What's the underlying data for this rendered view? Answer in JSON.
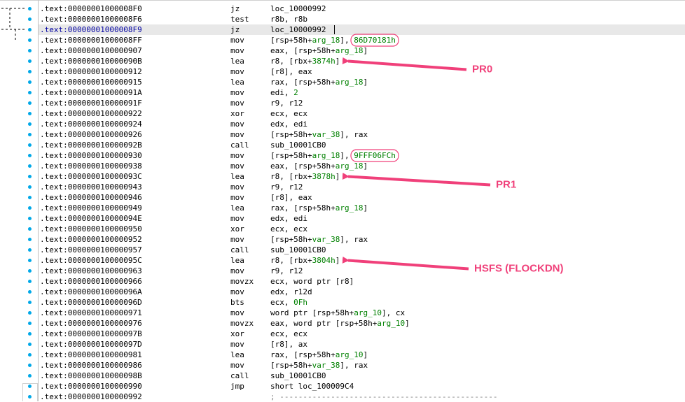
{
  "rows": [
    {
      "addr": ".text:00000001000008F0",
      "mnemonic": "jz",
      "parts": [
        {
          "t": "loc_10000992"
        }
      ]
    },
    {
      "addr": ".text:00000001000008F6",
      "mnemonic": "test",
      "parts": [
        {
          "t": "r8b, r8b"
        }
      ]
    },
    {
      "addr": ".text:00000001000008F9",
      "mnemonic": "jz",
      "parts": [
        {
          "t": "loc_10000992"
        }
      ]
    },
    {
      "addr": ".text:00000001000008FF",
      "mnemonic": "mov",
      "parts": [
        {
          "t": "[rsp+58h+"
        },
        {
          "t": "arg_18",
          "hl": true
        },
        {
          "t": "], "
        },
        {
          "t": "86D70181h",
          "hl": true
        }
      ]
    },
    {
      "addr": ".text:0000000100000907",
      "mnemonic": "mov",
      "parts": [
        {
          "t": "eax, [rsp+58h+"
        },
        {
          "t": "arg_18",
          "hl": true
        },
        {
          "t": "]"
        }
      ]
    },
    {
      "addr": ".text:000000010000090B",
      "mnemonic": "lea",
      "parts": [
        {
          "t": "r8, [rbx+"
        },
        {
          "t": "3874h",
          "hl": true
        },
        {
          "t": "]"
        }
      ]
    },
    {
      "addr": ".text:0000000100000912",
      "mnemonic": "mov",
      "parts": [
        {
          "t": "[r8], eax"
        }
      ]
    },
    {
      "addr": ".text:0000000100000915",
      "mnemonic": "lea",
      "parts": [
        {
          "t": "rax, [rsp+58h+"
        },
        {
          "t": "arg_18",
          "hl": true
        },
        {
          "t": "]"
        }
      ]
    },
    {
      "addr": ".text:000000010000091A",
      "mnemonic": "mov",
      "parts": [
        {
          "t": "edi, "
        },
        {
          "t": "2",
          "hl": true
        }
      ]
    },
    {
      "addr": ".text:000000010000091F",
      "mnemonic": "mov",
      "parts": [
        {
          "t": "r9, r12"
        }
      ]
    },
    {
      "addr": ".text:0000000100000922",
      "mnemonic": "xor",
      "parts": [
        {
          "t": "ecx, ecx"
        }
      ]
    },
    {
      "addr": ".text:0000000100000924",
      "mnemonic": "mov",
      "parts": [
        {
          "t": "edx, edi"
        }
      ]
    },
    {
      "addr": ".text:0000000100000926",
      "mnemonic": "mov",
      "parts": [
        {
          "t": "[rsp+58h+"
        },
        {
          "t": "var_38",
          "hl": true
        },
        {
          "t": "], rax"
        }
      ]
    },
    {
      "addr": ".text:000000010000092B",
      "mnemonic": "call",
      "parts": [
        {
          "t": "sub_10001CB0"
        }
      ]
    },
    {
      "addr": ".text:0000000100000930",
      "mnemonic": "mov",
      "parts": [
        {
          "t": "[rsp+58h+"
        },
        {
          "t": "arg_18",
          "hl": true
        },
        {
          "t": "], "
        },
        {
          "t": "9FFF06FCh",
          "hl": true
        }
      ]
    },
    {
      "addr": ".text:0000000100000938",
      "mnemonic": "mov",
      "parts": [
        {
          "t": "eax, [rsp+58h+"
        },
        {
          "t": "arg_18",
          "hl": true
        },
        {
          "t": "]"
        }
      ]
    },
    {
      "addr": ".text:000000010000093C",
      "mnemonic": "lea",
      "parts": [
        {
          "t": "r8, [rbx+"
        },
        {
          "t": "3878h",
          "hl": true
        },
        {
          "t": "]"
        }
      ]
    },
    {
      "addr": ".text:0000000100000943",
      "mnemonic": "mov",
      "parts": [
        {
          "t": "r9, r12"
        }
      ]
    },
    {
      "addr": ".text:0000000100000946",
      "mnemonic": "mov",
      "parts": [
        {
          "t": "[r8], eax"
        }
      ]
    },
    {
      "addr": ".text:0000000100000949",
      "mnemonic": "lea",
      "parts": [
        {
          "t": "rax, [rsp+58h+"
        },
        {
          "t": "arg_18",
          "hl": true
        },
        {
          "t": "]"
        }
      ]
    },
    {
      "addr": ".text:000000010000094E",
      "mnemonic": "mov",
      "parts": [
        {
          "t": "edx, edi"
        }
      ]
    },
    {
      "addr": ".text:0000000100000950",
      "mnemonic": "xor",
      "parts": [
        {
          "t": "ecx, ecx"
        }
      ]
    },
    {
      "addr": ".text:0000000100000952",
      "mnemonic": "mov",
      "parts": [
        {
          "t": "[rsp+58h+"
        },
        {
          "t": "var_38",
          "hl": true
        },
        {
          "t": "], rax"
        }
      ]
    },
    {
      "addr": ".text:0000000100000957",
      "mnemonic": "call",
      "parts": [
        {
          "t": "sub_10001CB0"
        }
      ]
    },
    {
      "addr": ".text:000000010000095C",
      "mnemonic": "lea",
      "parts": [
        {
          "t": "r8, [rbx+"
        },
        {
          "t": "3804h",
          "hl": true
        },
        {
          "t": "]"
        }
      ]
    },
    {
      "addr": ".text:0000000100000963",
      "mnemonic": "mov",
      "parts": [
        {
          "t": "r9, r12"
        }
      ]
    },
    {
      "addr": ".text:0000000100000966",
      "mnemonic": "movzx",
      "parts": [
        {
          "t": "ecx, word ptr [r8]"
        }
      ]
    },
    {
      "addr": ".text:000000010000096A",
      "mnemonic": "mov",
      "parts": [
        {
          "t": "edx, r12d"
        }
      ]
    },
    {
      "addr": ".text:000000010000096D",
      "mnemonic": "bts",
      "parts": [
        {
          "t": "ecx, "
        },
        {
          "t": "0Fh",
          "hl": true
        }
      ]
    },
    {
      "addr": ".text:0000000100000971",
      "mnemonic": "mov",
      "parts": [
        {
          "t": "word ptr [rsp+58h+"
        },
        {
          "t": "arg_10",
          "hl": true
        },
        {
          "t": "], cx"
        }
      ]
    },
    {
      "addr": ".text:0000000100000976",
      "mnemonic": "movzx",
      "parts": [
        {
          "t": "eax, word ptr [rsp+58h+"
        },
        {
          "t": "arg_10",
          "hl": true
        },
        {
          "t": "]"
        }
      ]
    },
    {
      "addr": ".text:000000010000097B",
      "mnemonic": "xor",
      "parts": [
        {
          "t": "ecx, ecx"
        }
      ]
    },
    {
      "addr": ".text:000000010000097D",
      "mnemonic": "mov",
      "parts": [
        {
          "t": "[r8], ax"
        }
      ]
    },
    {
      "addr": ".text:0000000100000981",
      "mnemonic": "lea",
      "parts": [
        {
          "t": "rax, [rsp+58h+"
        },
        {
          "t": "arg_10",
          "hl": true
        },
        {
          "t": "]"
        }
      ]
    },
    {
      "addr": ".text:0000000100000986",
      "mnemonic": "mov",
      "parts": [
        {
          "t": "[rsp+58h+"
        },
        {
          "t": "var_38",
          "hl": true
        },
        {
          "t": "], rax"
        }
      ]
    },
    {
      "addr": ".text:000000010000098B",
      "mnemonic": "call",
      "parts": [
        {
          "t": "sub_10001CB0"
        }
      ]
    },
    {
      "addr": ".text:0000000100000990",
      "mnemonic": "jmp",
      "parts": [
        {
          "t": "short loc_100009C4"
        }
      ]
    },
    {
      "addr": ".text:0000000100000992",
      "mnemonic": "",
      "parts": [
        {
          "t": "; -----------------------------------------------",
          "cm": true
        }
      ]
    }
  ],
  "selected_row": 2,
  "annotations": [
    {
      "text": "PR0",
      "row": 5,
      "circle_row": 3
    },
    {
      "text": "PR1",
      "row": 16,
      "circle_row": 14
    },
    {
      "text": "HSFS (FLOCKDN)",
      "row": 24,
      "circle_row": null
    }
  ],
  "colors": {
    "annotation": "#f0407a",
    "operand_highlight": "#008000",
    "selection": "#e8e8e8",
    "gutter_dot": "#00a8e8"
  }
}
